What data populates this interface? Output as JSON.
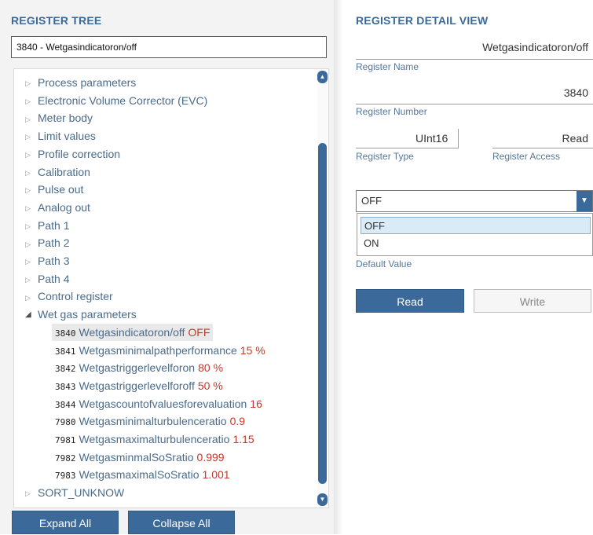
{
  "left": {
    "title": "REGISTER TREE",
    "search_value": "3840 - Wetgasindicatoron/off",
    "categories": [
      "Process parameters",
      "Electronic Volume Corrector (EVC)",
      "Meter body",
      "Limit values",
      "Profile correction",
      "Calibration",
      "Pulse out",
      "Analog out",
      "Path 1",
      "Path 2",
      "Path 3",
      "Path 4",
      "Control register"
    ],
    "expanded_category": "Wet gas parameters",
    "registers": [
      {
        "num": "3840",
        "name": "Wetgasindicatoron/off",
        "value": "OFF"
      },
      {
        "num": "3841",
        "name": "Wetgasminimalpathperformance",
        "value": "15 %"
      },
      {
        "num": "3842",
        "name": "Wetgastriggerlevelforon",
        "value": "80 %"
      },
      {
        "num": "3843",
        "name": "Wetgastriggerlevelforoff",
        "value": "50 %"
      },
      {
        "num": "3844",
        "name": "Wetgascountofvaluesforevaluation",
        "value": "16"
      },
      {
        "num": "7980",
        "name": "Wetgasminimalturbulenceratio",
        "value": "0.9"
      },
      {
        "num": "7981",
        "name": "Wetgasmaximalturbulenceratio",
        "value": "1.15"
      },
      {
        "num": "7982",
        "name": "WetgasminmalSoSratio",
        "value": "0.999"
      },
      {
        "num": "7983",
        "name": "WetgasmaximalSoSratio",
        "value": "1.001"
      }
    ],
    "last_category": "SORT_UNKNOW",
    "expand_all_label": "Expand All",
    "collapse_all_label": "Collapse All"
  },
  "right": {
    "title": "REGISTER DETAIL VIEW",
    "register_name": "Wetgasindicatoron/off",
    "register_name_label": "Register Name",
    "register_number": "3840",
    "register_number_label": "Register Number",
    "register_type": "UInt16",
    "register_type_label": "Register Type",
    "register_access": "Read",
    "register_access_label": "Register Access",
    "default_value_selected": "OFF",
    "default_value_options": [
      "OFF",
      "ON"
    ],
    "default_value_label": "Default Value",
    "read_label": "Read",
    "write_label": "Write"
  },
  "colors": {
    "accent": "#3b6a9a",
    "value_red": "#c0392b",
    "tree_text": "#4a6b8a"
  },
  "icons": {
    "collapsed": "triangle-right-icon",
    "expanded": "triangle-down-icon",
    "dropdown": "chevron-down-icon"
  }
}
